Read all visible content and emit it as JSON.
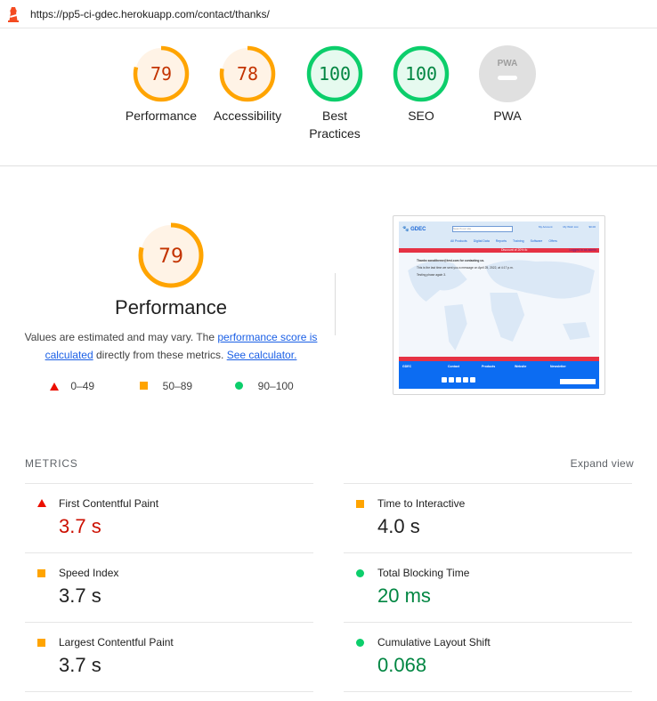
{
  "address_bar": {
    "icon": "lighthouse-icon",
    "url": "https://pp5-ci-gdec.herokuapp.com/contact/thanks/"
  },
  "colors": {
    "fail": "#eb0f00",
    "average": "#ffa400",
    "pass": "#0cce6b",
    "na": "#e0e0e0",
    "link": "#1a5fe6"
  },
  "gauges": [
    {
      "label": "Performance",
      "score": "79",
      "value": 79,
      "status": "average"
    },
    {
      "label": "Accessibility",
      "score": "78",
      "value": 78,
      "status": "average"
    },
    {
      "label": "Best Practices",
      "score": "100",
      "value": 100,
      "status": "pass"
    },
    {
      "label": "SEO",
      "score": "100",
      "value": 100,
      "status": "pass"
    },
    {
      "label": "PWA",
      "score": "",
      "value": null,
      "status": "na",
      "badge_text": "PWA"
    }
  ],
  "performance": {
    "score": "79",
    "value": 79,
    "title": "Performance",
    "desc_prefix": "Values are estimated and may vary. The ",
    "link1": "performance score is calculated",
    "desc_middle": " directly from these metrics. ",
    "link2": "See calculator.",
    "legend": [
      {
        "shape": "triangle",
        "range": "0–49"
      },
      {
        "shape": "square",
        "range": "50–89"
      },
      {
        "shape": "circle",
        "range": "90–100"
      }
    ]
  },
  "screenshot": {
    "logo": "GDEC",
    "search_placeholder": "Search our site",
    "header_icons": [
      "My Account",
      "My Wish List",
      "$0.00"
    ],
    "nav": [
      "All Products",
      "Digital Data",
      "Reports",
      "Training",
      "Software",
      "Offers"
    ],
    "banner": "Discount of 20% fo",
    "admin": "Logged in as admin",
    "messages": [
      "Thanks sonaltheme@test.com for contacting us.",
      "This is the last time we sent you a message on April 25, 2022, at 4:17 p.m.",
      "Testing phase again 3."
    ],
    "footer": {
      "logo": "GDEC",
      "columns": [
        "Contact",
        "Products",
        "Website",
        "Newsletter"
      ],
      "newsletter_placeholder": "Enter a email address"
    }
  },
  "metrics": {
    "header": "METRICS",
    "expand_label": "Expand view",
    "items": [
      {
        "name": "First Contentful Paint",
        "value": "3.7 s",
        "status": "fail"
      },
      {
        "name": "Time to Interactive",
        "value": "4.0 s",
        "status": "average"
      },
      {
        "name": "Speed Index",
        "value": "3.7 s",
        "status": "average"
      },
      {
        "name": "Total Blocking Time",
        "value": "20 ms",
        "status": "pass"
      },
      {
        "name": "Largest Contentful Paint",
        "value": "3.7 s",
        "status": "average"
      },
      {
        "name": "Cumulative Layout Shift",
        "value": "0.068",
        "status": "pass"
      }
    ]
  }
}
